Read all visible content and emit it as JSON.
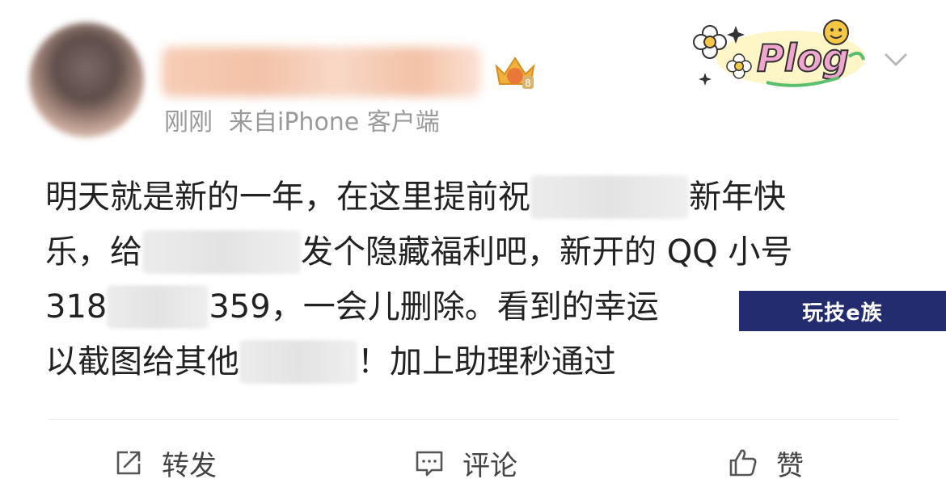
{
  "header": {
    "time": "刚刚",
    "source": "来自iPhone 客户端",
    "sticker_text": "Plog"
  },
  "post": {
    "line1_a": "明天就是新的一年，在这里提前祝",
    "line1_b": "新年快",
    "line2_a": "乐，给",
    "line2_b": "发个隐藏福利吧，新开的 QQ 小号",
    "line3_a": "318",
    "line3_b": "359，一会儿删除。看到的幸运",
    "line4_a": "以截图给其他",
    "line4_b": "！加上助理秒通过"
  },
  "watermark": "玩技e族",
  "actions": {
    "repost": "转发",
    "comment": "评论",
    "like": "赞"
  },
  "colors": {
    "meta_text": "#9a9a9a",
    "body_text": "#222222",
    "watermark_bg": "#232c6e"
  }
}
